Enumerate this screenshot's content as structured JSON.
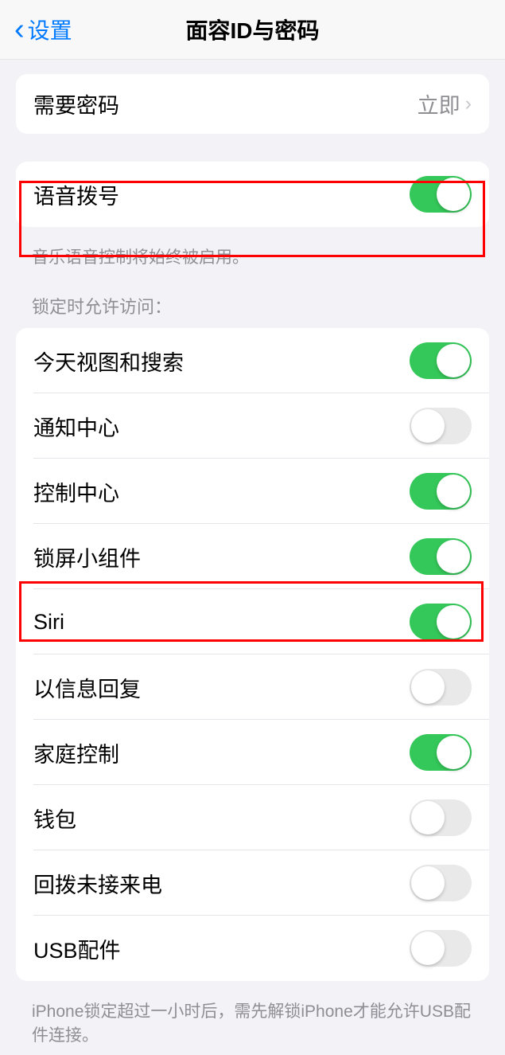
{
  "header": {
    "back_label": "设置",
    "title": "面容ID与密码"
  },
  "require_passcode": {
    "label": "需要密码",
    "value": "立即"
  },
  "voice_dial": {
    "label": "语音拨号",
    "on": true,
    "footer": "音乐语音控制将始终被启用。"
  },
  "lock_access": {
    "header": "锁定时允许访问：",
    "items": [
      {
        "label": "今天视图和搜索",
        "on": true
      },
      {
        "label": "通知中心",
        "on": false
      },
      {
        "label": "控制中心",
        "on": true
      },
      {
        "label": "锁屏小组件",
        "on": true
      },
      {
        "label": "Siri",
        "on": true
      },
      {
        "label": "以信息回复",
        "on": false
      },
      {
        "label": "家庭控制",
        "on": true
      },
      {
        "label": "钱包",
        "on": false
      },
      {
        "label": "回拨未接来电",
        "on": false
      },
      {
        "label": "USB配件",
        "on": false
      }
    ],
    "footer": "iPhone锁定超过一小时后，需先解锁iPhone才能允许USB配件连接。"
  }
}
